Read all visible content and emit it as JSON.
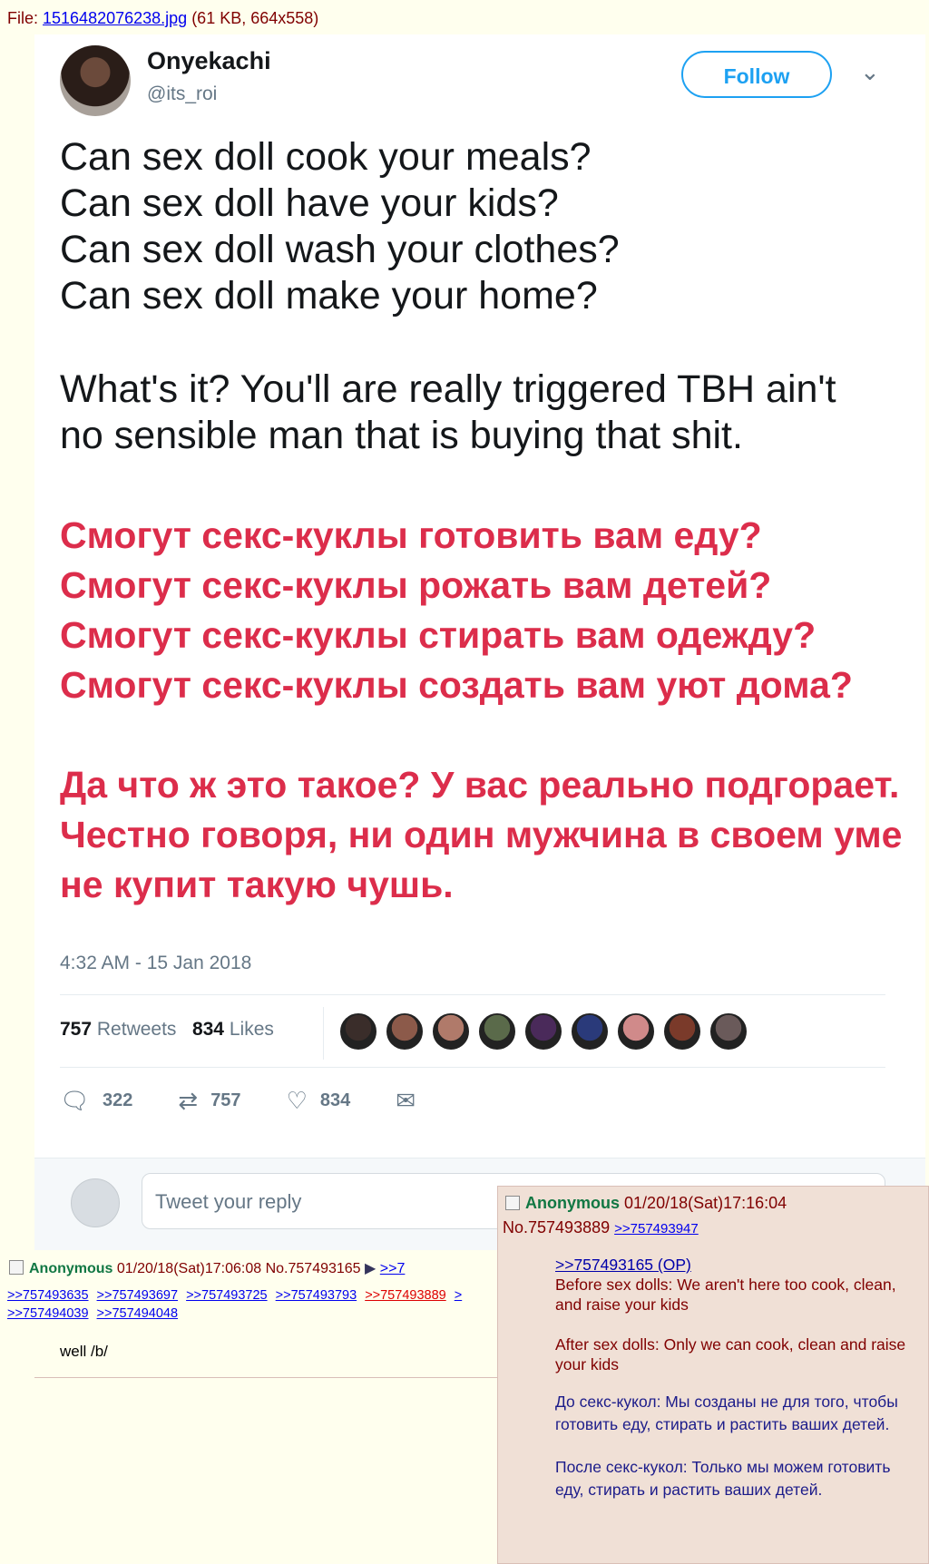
{
  "file": {
    "prefix": "File: ",
    "name": "1516482076238.jpg",
    "meta": " (61 KB, 664x558)"
  },
  "tweet": {
    "author_name": "Onyekachi",
    "author_handle": "@its_roi",
    "follow_label": "Follow",
    "chevron": "⌄",
    "lines": [
      "Can sex doll cook your meals?",
      "Can sex doll have your kids?",
      "Can sex doll wash your clothes?",
      "Can sex doll make your home?",
      "What's it? You'll are really triggered TBH ain't",
      "no sensible man that is buying that shit."
    ],
    "ru_lines": [
      "Смогут секс-куклы готовить вам еду?",
      "Смогут секс-куклы рожать вам детей?",
      "Смогут секс-куклы стирать вам одежду?",
      "Смогут секс-куклы создать вам уют дома?",
      "Да что ж это такое? У вас реально подгорает.",
      "Честно говоря, ни один мужчина в своем уме",
      "не купит такую чушь."
    ],
    "timestamp": "4:32 AM - 15 Jan 2018",
    "retweets_count": "757",
    "retweets_label": "Retweets",
    "likes_count": "834",
    "likes_label": "Likes",
    "actions": {
      "replies": "322",
      "retweets": "757",
      "likes": "834"
    },
    "reply_placeholder": "Tweet your reply",
    "liker_colors": [
      "#3a2d2a",
      "#8c5a4a",
      "#b07a6a",
      "#5a6a4a",
      "#4a2a5a",
      "#2a3a7a",
      "#d08a8a",
      "#7a3a2a",
      "#6a5a5a"
    ]
  },
  "post": {
    "name": "Anonymous",
    "datetime": "01/20/18(Sat)17:06:08",
    "no": "No.757493165",
    "tri": "▶",
    "cut_link": ">>7",
    "backlinks_row1": [
      ">>757493635",
      ">>757493697",
      ">>757493725",
      ">>757493793",
      ">>757493889",
      ">"
    ],
    "backlinks_row2": [
      ">>757494039",
      ">>757494048"
    ],
    "message": "well /b/"
  },
  "popup": {
    "name": "Anonymous",
    "datetime": "01/20/18(Sat)17:16:04",
    "no": "No.757493889",
    "reply_link": ">>757493947",
    "quote_link": ">>757493165 (OP)",
    "en1": "Before sex dolls: We aren't here too cook, clean, and raise your kids",
    "en2": "After sex dolls: Only we can cook, clean and raise your kids",
    "ru1": "До секс-кукол: Мы созданы не для того, чтобы готовить еду, стирать и растить ваших детей.",
    "ru2": "После секс-кукол: Только мы можем готовить еду, стирать и растить ваших детей."
  },
  "colors": {
    "arrow": "#e81e1e",
    "ru_text": "#dc2d4b",
    "twitter_blue": "#1da1f2"
  }
}
